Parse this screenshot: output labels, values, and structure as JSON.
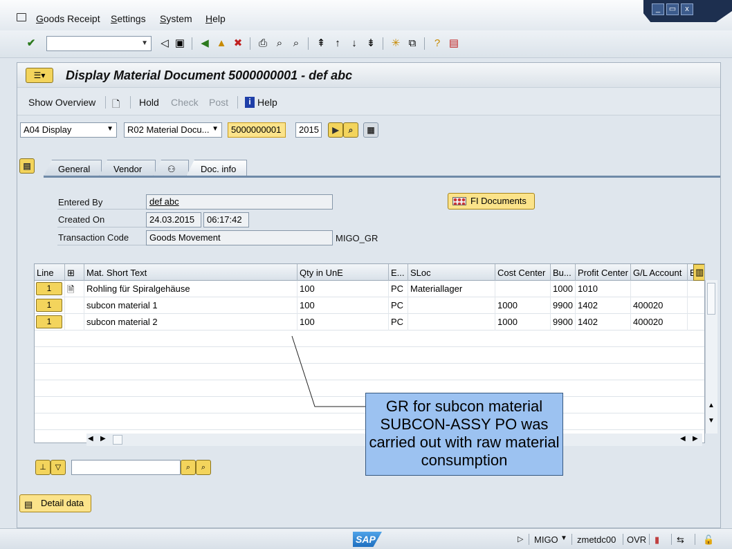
{
  "menu": {
    "items": [
      "Goods Receipt",
      "Settings",
      "System",
      "Help"
    ]
  },
  "window_controls": {
    "minimize": "_",
    "restore": "▭",
    "close": "x"
  },
  "title": "Display Material Document 5000000001 - def abc",
  "app_toolbar": {
    "show_overview": "Show Overview",
    "hold": "Hold",
    "check": "Check",
    "post": "Post",
    "help": "Help"
  },
  "header_fields": {
    "action": "A04 Display",
    "reference": "R02 Material Docu...",
    "doc_number": "5000000001",
    "year": "2015"
  },
  "tabs": [
    "General",
    "Vendor",
    "",
    "Doc. info"
  ],
  "doc_info": {
    "entered_by_label": "Entered By",
    "entered_by": "def abc",
    "created_on_label": "Created On",
    "created_date": "24.03.2015",
    "created_time": "06:17:42",
    "transaction_code_label": "Transaction Code",
    "transaction_code": "Goods Movement",
    "transaction_code_value": "MIGO_GR",
    "fi_documents": "FI Documents"
  },
  "table": {
    "columns": [
      "Line",
      "",
      "Mat. Short Text",
      "Qty in UnE",
      "E...",
      "SLoc",
      "Cost Center",
      "Bu...",
      "Profit Center",
      "G/L Account",
      "Batch"
    ],
    "rows": [
      {
        "line": "1",
        "text": "Rohling für Spiralgehäuse",
        "qty": "100",
        "unit": "PC",
        "sloc": "Materiallager",
        "cost_center": "",
        "bu": "1000",
        "profit_center": "1010",
        "gl": ""
      },
      {
        "line": "1",
        "text": "subcon material 1",
        "qty": "100",
        "unit": "PC",
        "sloc": "",
        "cost_center": "1000",
        "bu": "9900",
        "profit_center": "1402",
        "gl": "400020"
      },
      {
        "line": "1",
        "text": "subcon material 2",
        "qty": "100",
        "unit": "PC",
        "sloc": "",
        "cost_center": "1000",
        "bu": "9900",
        "profit_center": "1402",
        "gl": "400020"
      }
    ]
  },
  "callout": "GR for subcon material SUBCON-ASSY PO was carried out with raw material consumption",
  "detail_data": "Detail data",
  "status": {
    "logo": "SAP",
    "transaction": "MIGO",
    "server": "zmetdc00",
    "mode": "OVR"
  }
}
